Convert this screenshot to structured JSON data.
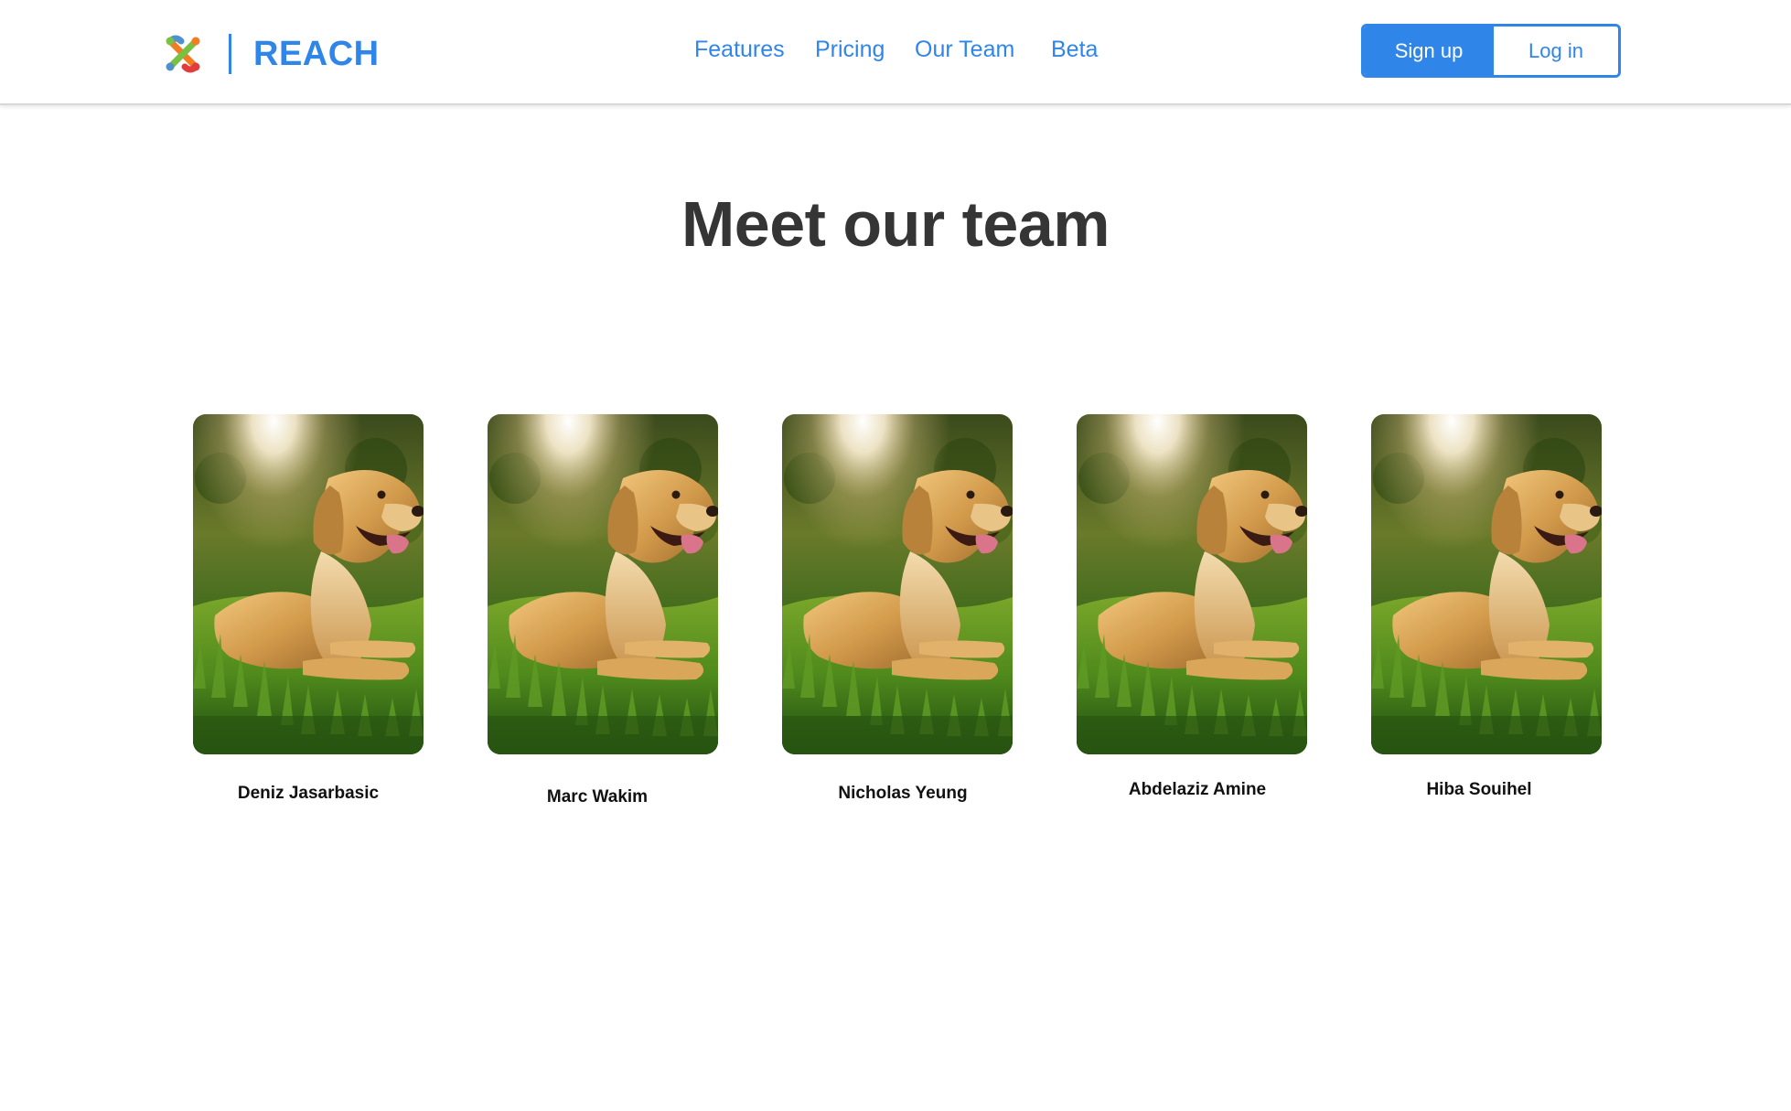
{
  "header": {
    "brand_name": "REACH",
    "brand_color": "#2f86e8",
    "nav": {
      "features": "Features",
      "pricing": "Pricing",
      "team": "Our Team",
      "beta": "Beta"
    },
    "signup_label": "Sign up",
    "login_label": "Log in"
  },
  "main": {
    "title": "Meet our team",
    "photo_icon": "golden-retriever-photo",
    "members": [
      {
        "name": "Deniz Jasarbasic"
      },
      {
        "name": "Marc Wakim"
      },
      {
        "name": "Nicholas Yeung"
      },
      {
        "name": "Abdelaziz Amine"
      },
      {
        "name": "Hiba Souihel"
      }
    ]
  }
}
